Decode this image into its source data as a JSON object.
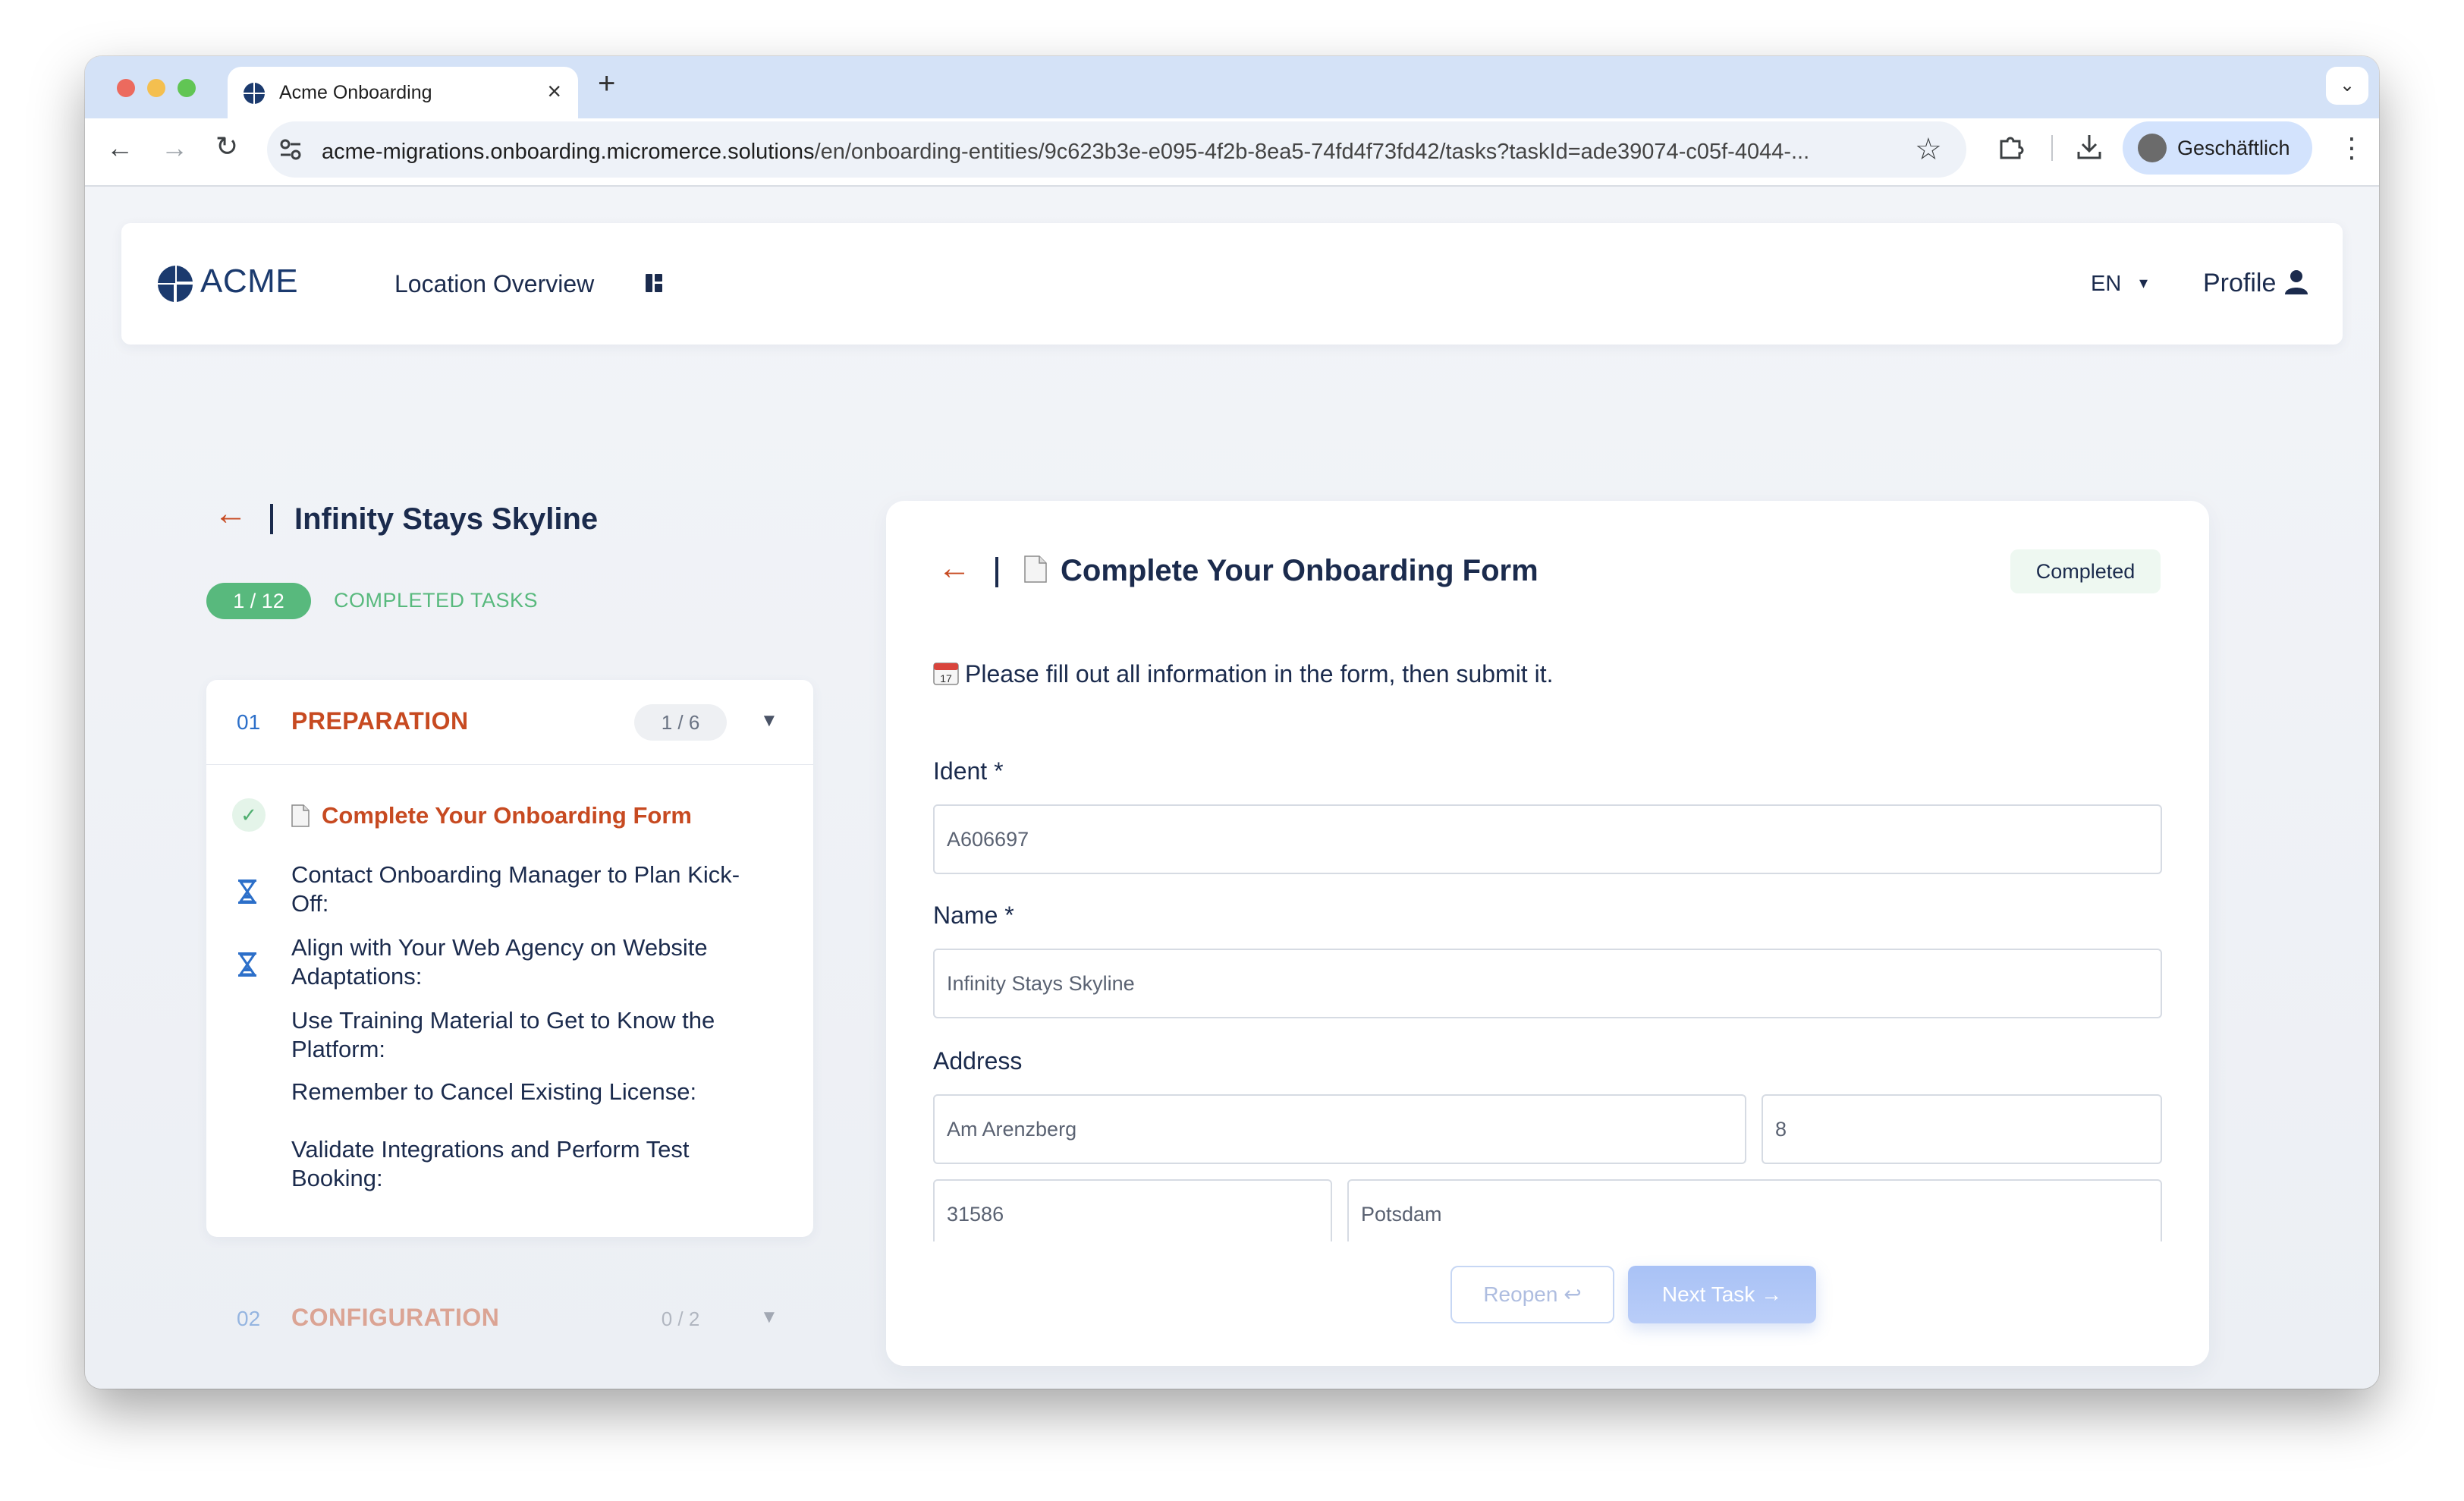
{
  "browser": {
    "tab_title": "Acme Onboarding",
    "url_domain": "acme-migrations.onboarding.micromerce.solutions",
    "url_path": "/en/onboarding-entities/9c623b3e-e095-4f2b-8ea5-74fd4f73fd42/tasks?taskId=ade39074-c05f-4044-...",
    "profile_name": "Geschäftlich"
  },
  "header": {
    "logo_text": "ACME",
    "nav_location_overview": "Location Overview",
    "language": "EN",
    "profile": "Profile"
  },
  "location": {
    "title": "Infinity Stays Skyline",
    "progress": "1 / 12",
    "progress_label": "COMPLETED TASKS"
  },
  "phases": [
    {
      "number": "01",
      "name": "PREPARATION",
      "count": "1 / 6",
      "tasks": [
        {
          "label": "Complete Your Onboarding Form",
          "status": "completed"
        },
        {
          "label": "Contact Onboarding Manager to Plan Kick-Off:",
          "status": "pending"
        },
        {
          "label": "Align with Your Web Agency on Website Adaptations:",
          "status": "pending"
        },
        {
          "label": "Use Training Material to Get to Know the Platform:",
          "status": "none"
        },
        {
          "label": "Remember to Cancel Existing License:",
          "status": "none"
        },
        {
          "label": "Validate Integrations and Perform Test Booking:",
          "status": "none"
        }
      ]
    },
    {
      "number": "02",
      "name": "CONFIGURATION",
      "count": "0 / 2"
    }
  ],
  "task_detail": {
    "title": "Complete Your Onboarding Form",
    "status": "Completed",
    "instructions": "Please fill out all information in the form, then submit it.",
    "fields": {
      "ident_label": "Ident *",
      "ident_value": "A606697",
      "name_label": "Name *",
      "name_value": "Infinity Stays Skyline",
      "address_label": "Address",
      "street": "Am Arenzberg",
      "house_number": "8",
      "postal_code": "31586",
      "city": "Potsdam"
    },
    "reopen_label": "Reopen",
    "next_label": "Next Task"
  },
  "colors": {
    "accent_orange": "#c74a21",
    "success_green": "#58b97d",
    "navy": "#1b2b4d",
    "link_blue": "#2c6fc9"
  }
}
